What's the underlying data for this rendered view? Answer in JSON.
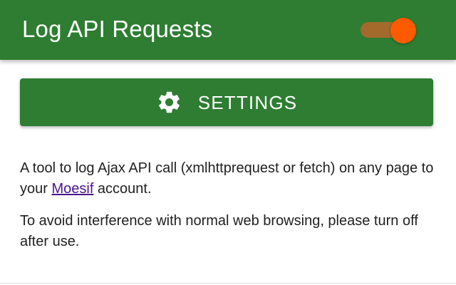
{
  "header": {
    "title": "Log API Requests",
    "toggle_on": true,
    "toggle_track_color": "#a36a2c",
    "toggle_thumb_color": "#ff5a00",
    "background_color": "#2e7d32"
  },
  "settings_button": {
    "label": "SETTINGS",
    "icon": "gear-icon"
  },
  "description": {
    "paragraph1_before_link": "A tool to log Ajax API call (xmlhttprequest or fetch) on any page to your ",
    "link_text": "Moesif",
    "paragraph1_after_link": " account.",
    "paragraph2": "To avoid interference with normal web browsing, please turn off after use."
  }
}
